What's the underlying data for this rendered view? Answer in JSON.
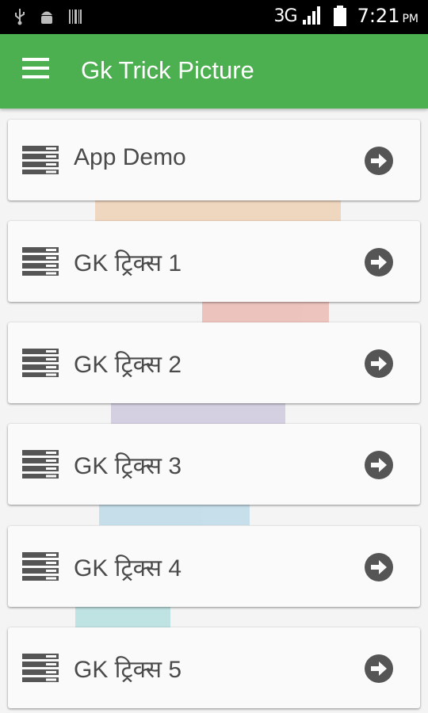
{
  "status_bar": {
    "network": "3G",
    "time": "7:21",
    "ampm": "PM"
  },
  "app_bar": {
    "title": "Gk Trick Picture"
  },
  "colors": {
    "primary": "#4caf50",
    "icon": "#555555",
    "text": "#4a4a4a"
  },
  "list": {
    "items": [
      {
        "label": "App Demo"
      },
      {
        "label": "GK ट्रिक्स 1"
      },
      {
        "label": "GK ट्रिक्स 2"
      },
      {
        "label": "GK ट्रिक्स 3"
      },
      {
        "label": "GK ट्रिक्स 4"
      },
      {
        "label": "GK ट्रिक्स 5"
      }
    ]
  },
  "icons": {
    "item_icon": "list-lines-icon",
    "item_action": "arrow-right-circle-icon"
  }
}
